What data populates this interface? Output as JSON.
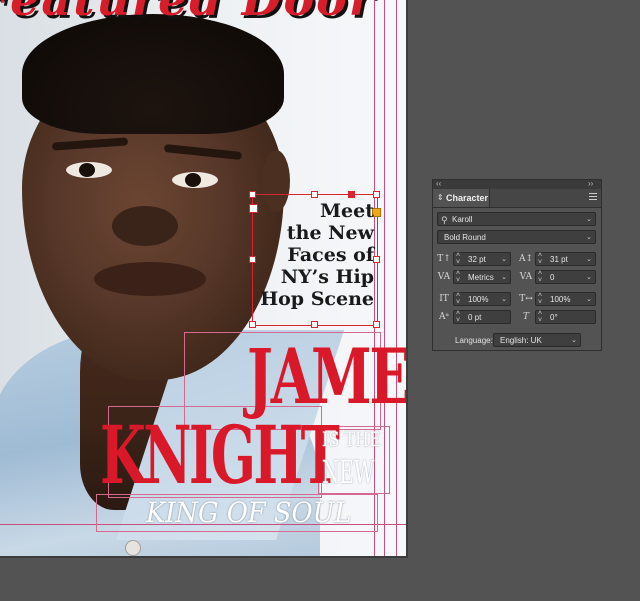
{
  "document": {
    "masthead_text": "Featured Door",
    "tagline_lines": [
      "Meet",
      "the New",
      "Faces of",
      "NY’s Hip",
      "Hop Scene"
    ],
    "headline_first": "JAMES",
    "headline_last": "KNIGHT",
    "is_the": "IS THE",
    "new": "NEW",
    "subhead": "KING OF SOUL",
    "colors": {
      "headline_red": "#d9192a",
      "guide_magenta": "#c8507c",
      "selection_red": "#d9252f"
    }
  },
  "character_panel": {
    "title": "Character",
    "font_family": "Karoll",
    "font_style": "Bold Round",
    "font_size": "32 pt",
    "leading": "31 pt",
    "kerning": "Metrics",
    "tracking": "0",
    "vertical_scale": "100%",
    "horizontal_scale": "100%",
    "baseline_shift": "0 pt",
    "skew": "0°",
    "language_label": "Language:",
    "language_value": "English: UK",
    "icons": {
      "font_size": "font-size-icon",
      "leading": "leading-icon",
      "kerning": "kerning-icon",
      "tracking": "tracking-icon",
      "vertical_scale": "vertical-scale-icon",
      "horizontal_scale": "horizontal-scale-icon",
      "baseline_shift": "baseline-shift-icon",
      "skew": "skew-icon",
      "search": "search-icon",
      "menu": "panel-menu-icon"
    }
  }
}
